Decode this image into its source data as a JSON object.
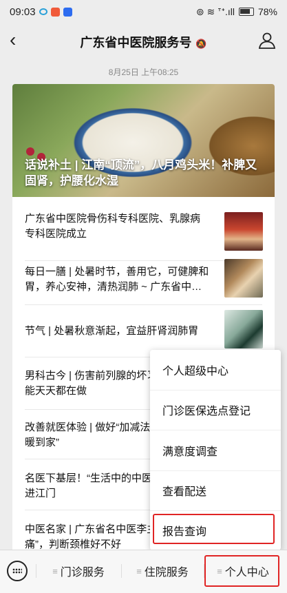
{
  "status_bar": {
    "time": "09:03",
    "battery": "78%",
    "signal": "⊚ ≋ ᐪᐩ.ıll"
  },
  "nav": {
    "title": "广东省中医院服务号",
    "bell": "🔕"
  },
  "timestamp": "8月25日 上午08:25",
  "hero": {
    "title": "话说补土 | 江南“顶流”，八月鸡头米！补脾又固肾，护腰化水湿"
  },
  "articles": [
    {
      "title": "广东省中医院骨伤科专科医院、乳腺病专科医院成立"
    },
    {
      "title": "每日一膳 | 处暑时节，善用它，可健脾和胃，养心安神，清热润肺 ~ 广东省中…"
    },
    {
      "title": "节气 | 处暑秋意渐起，宜益肝肾润肺胃"
    },
    {
      "title": "男科古今 | 伤害前列腺的坏习惯，让你不能天天都在做"
    },
    {
      "title": "改善就医体验 | 做好“加减法”，让患者“温暖到家”"
    },
    {
      "title": "名医下基层！“生活中的中医”系列讲座走进江门"
    },
    {
      "title": "中医名家 | 广东省名中医李主任：颈椎酸痛”，判断颈椎好不好"
    }
  ],
  "popup_menu": {
    "items": [
      "个人超级中心",
      "门诊医保选点登记",
      "满意度调查",
      "查看配送",
      "报告查询"
    ]
  },
  "bottom_tabs": [
    {
      "label": "门诊服务",
      "prefix": "≡"
    },
    {
      "label": "住院服务",
      "prefix": "≡"
    },
    {
      "label": "个人中心",
      "prefix": "≡"
    }
  ],
  "colors": {
    "highlight": "#e02424",
    "background": "#ededed"
  }
}
